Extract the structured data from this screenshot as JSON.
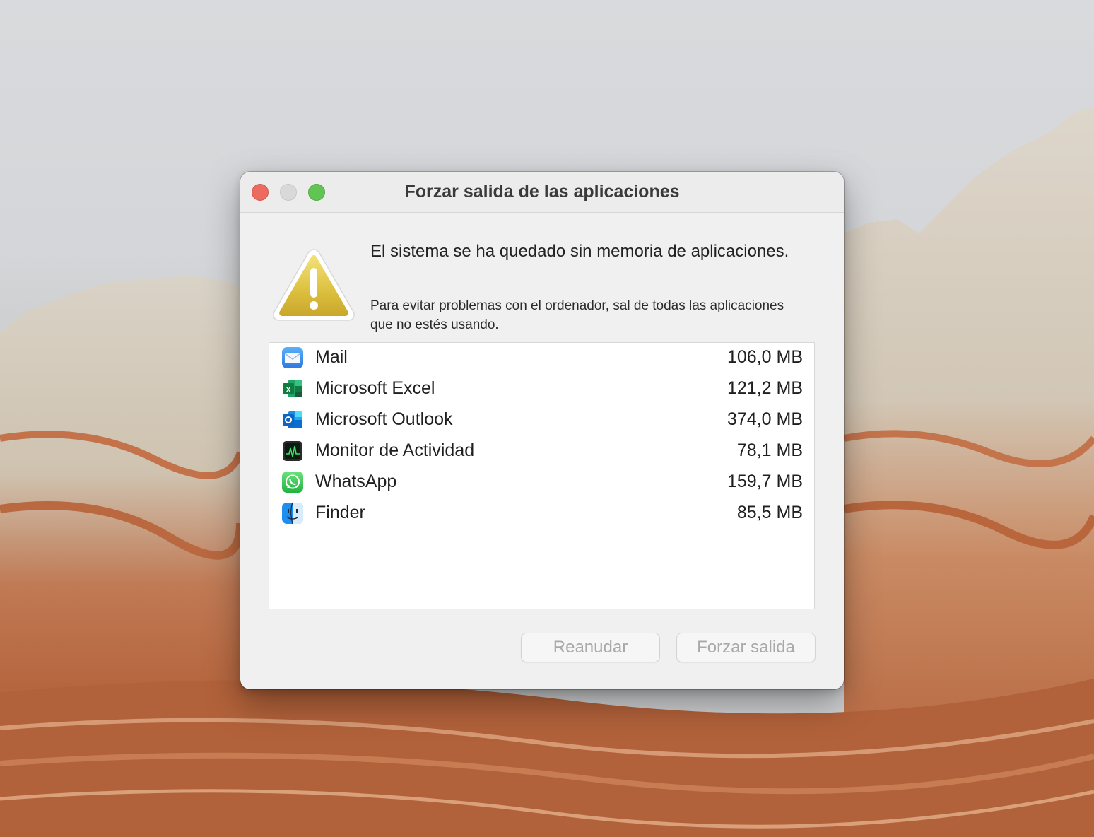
{
  "window": {
    "title": "Forzar salida de las aplicaciones"
  },
  "alert": {
    "icon": "warning-icon",
    "heading": "El sistema se ha quedado sin memoria de aplicaciones.",
    "message": "Para evitar problemas con el ordenador, sal de todas las aplicaciones que no estés usando."
  },
  "apps": [
    {
      "name": "Mail",
      "memory": "106,0 MB",
      "icon": "mail-icon"
    },
    {
      "name": "Microsoft Excel",
      "memory": "121,2 MB",
      "icon": "excel-icon"
    },
    {
      "name": "Microsoft Outlook",
      "memory": "374,0 MB",
      "icon": "outlook-icon"
    },
    {
      "name": "Monitor de Actividad",
      "memory": "78,1 MB",
      "icon": "activity-monitor-icon"
    },
    {
      "name": "WhatsApp",
      "memory": "159,7 MB",
      "icon": "whatsapp-icon"
    },
    {
      "name": "Finder",
      "memory": "85,5 MB",
      "icon": "finder-icon"
    }
  ],
  "buttons": {
    "resume": "Reanudar",
    "force_quit": "Forzar salida"
  },
  "colors": {
    "close": "#ec6a5e",
    "minimize": "#d9d9d9",
    "zoom": "#61c554",
    "warning": "#e0c24a"
  }
}
